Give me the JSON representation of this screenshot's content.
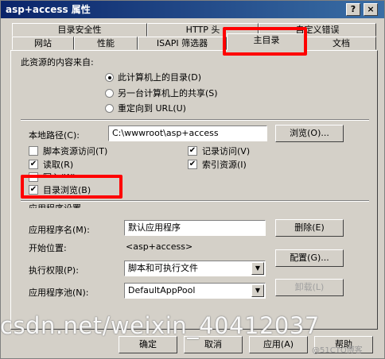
{
  "window": {
    "title": "asp+access 属性",
    "help_button": "?",
    "close_button": "×"
  },
  "tabs": {
    "row1": [
      "目录安全性",
      "HTTP 头",
      "自定义错误"
    ],
    "row2": [
      "网站",
      "性能",
      "ISAPI 筛选器",
      "主目录",
      "文档"
    ],
    "active": "主目录"
  },
  "content_source": {
    "label": "此资源的内容来自:",
    "options": [
      "此计算机上的目录(D)",
      "另一台计算机上的共享(S)",
      "重定向到 URL(U)"
    ],
    "selected_index": 0
  },
  "local_path": {
    "label": "本地路径(C):",
    "value": "C:\\wwwroot\\asp+access",
    "browse_button": "浏览(O)..."
  },
  "permissions": {
    "script_source": {
      "label": "脚本资源访问(T)",
      "checked": false
    },
    "read": {
      "label": "读取(R)",
      "checked": true
    },
    "write": {
      "label": "写入(W)",
      "checked": false
    },
    "dir_browse": {
      "label": "目录浏览(B)",
      "checked": true
    },
    "log_visits": {
      "label": "记录访问(V)",
      "checked": true
    },
    "index_resource": {
      "label": "索引资源(I)",
      "checked": true
    }
  },
  "app_settings": {
    "section_label": "应用程序设置",
    "app_name_label": "应用程序名(M):",
    "app_name_value": "默认应用程序",
    "remove_button": "删除(E)",
    "start_label": "开始位置:",
    "start_value": "<asp+access>",
    "config_button": "配置(G)...",
    "exec_label": "执行权限(P):",
    "exec_value": "脚本和可执行文件",
    "pool_label": "应用程序池(N):",
    "pool_value": "DefaultAppPool",
    "unload_button": "卸载(L)"
  },
  "footer": {
    "ok": "确定",
    "cancel": "取消",
    "apply": "应用(A)",
    "help": "帮助"
  },
  "watermark": {
    "text": "csdn.net/weixin_40412037",
    "small": "@51CTO博客"
  },
  "colors": {
    "highlight": "#ff0000",
    "titlebar": "#0a246a",
    "face": "#d4d0c8"
  }
}
